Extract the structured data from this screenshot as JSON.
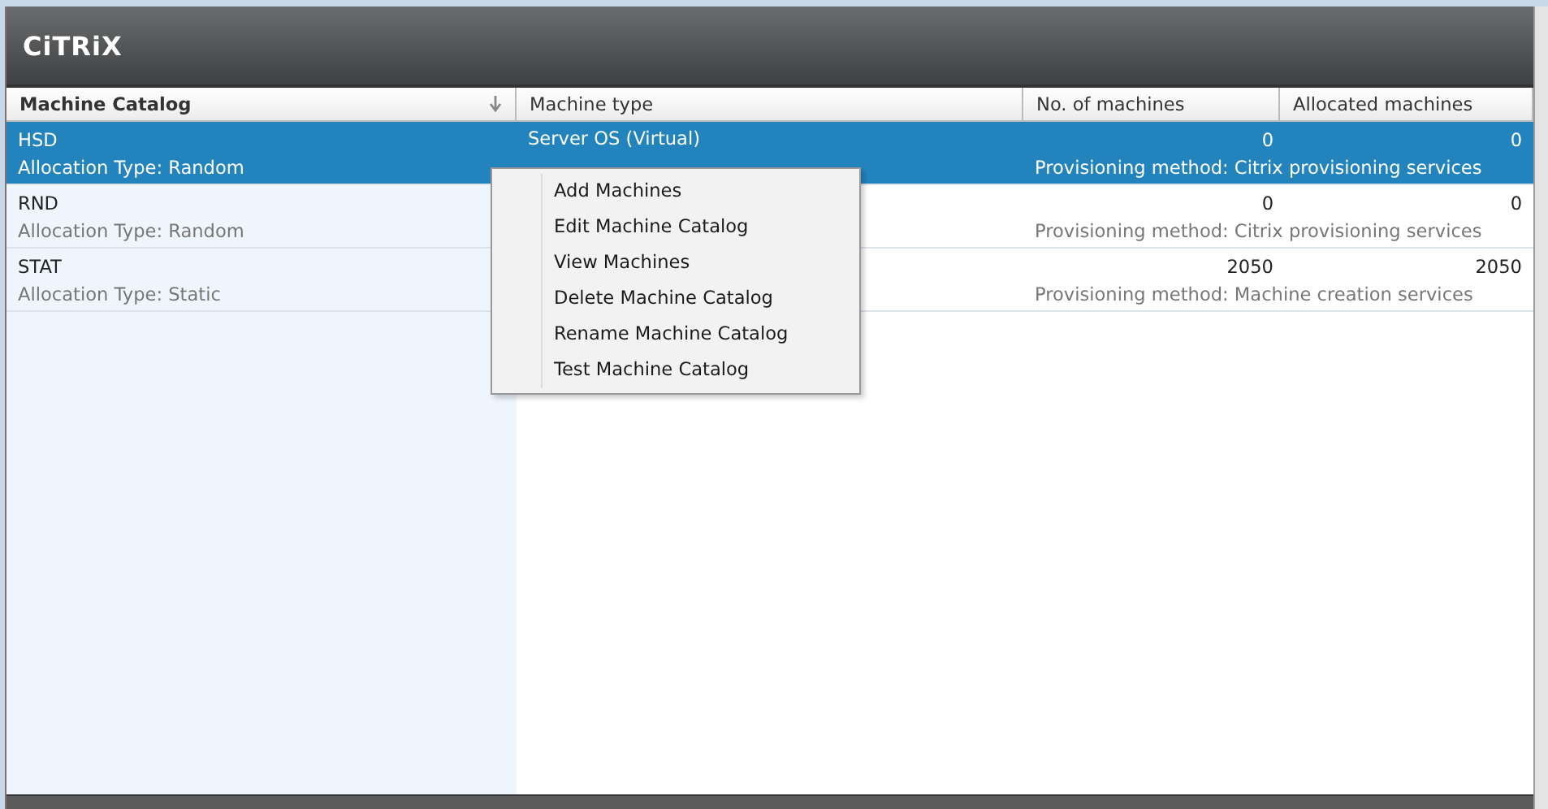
{
  "header": {
    "logo": "CiTRiX"
  },
  "table": {
    "columns": [
      {
        "label": "Machine Catalog",
        "sorted": true
      },
      {
        "label": "Machine type",
        "sorted": false
      },
      {
        "label": "No. of machines",
        "sorted": false
      },
      {
        "label": "Allocated machines",
        "sorted": false
      }
    ],
    "rows": [
      {
        "name": "HSD",
        "allocation": "Allocation Type: Random",
        "machine_type": "Server OS (Virtual)",
        "machines": "0",
        "allocated": "0",
        "provisioning": "Provisioning method: Citrix provisioning services",
        "selected": true
      },
      {
        "name": "RND",
        "allocation": "Allocation Type: Random",
        "machines": "0",
        "allocated": "0",
        "provisioning": "Provisioning method: Citrix provisioning services",
        "selected": false
      },
      {
        "name": "STAT",
        "allocation": "Allocation Type: Static",
        "machines": "2050",
        "allocated": "2050",
        "provisioning": "Provisioning method: Machine creation services",
        "selected": false
      }
    ]
  },
  "context_menu": {
    "items": [
      "Add Machines",
      "Edit Machine Catalog",
      "View Machines",
      "Delete Machine Catalog",
      "Rename Machine Catalog",
      "Test Machine Catalog"
    ]
  }
}
